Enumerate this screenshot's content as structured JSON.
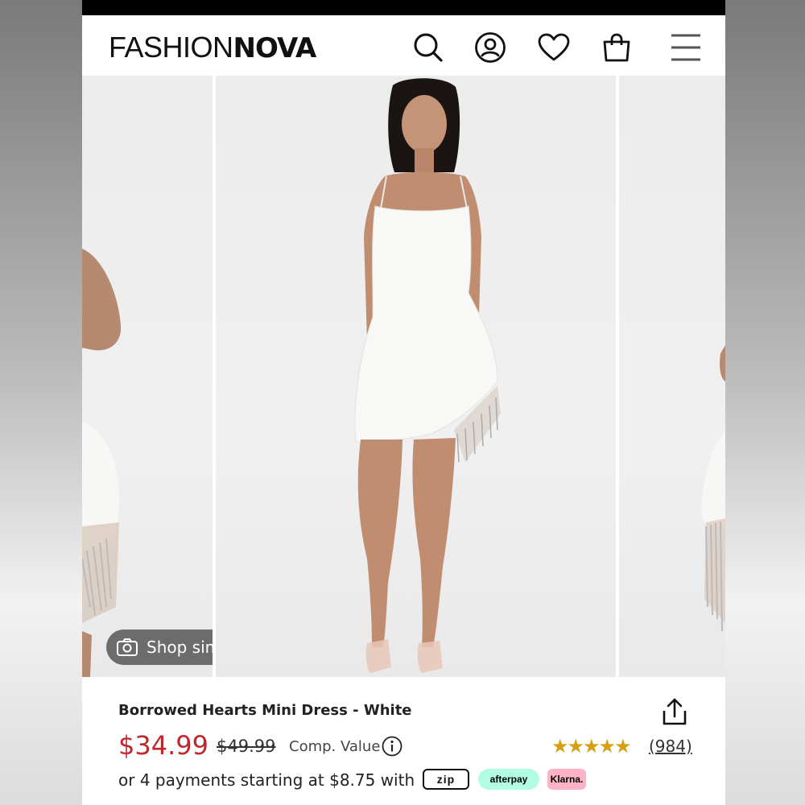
{
  "header": {
    "logo_thin": "FASHION",
    "logo_bold": "NOVA"
  },
  "icons": {
    "search": "search-icon",
    "account": "account-icon",
    "wishlist": "heart-icon",
    "cart": "bag-icon",
    "menu": "menu-icon"
  },
  "gallery": {
    "shop_similar_label": "Shop similar"
  },
  "product": {
    "title": "Borrowed Hearts Mini Dress - White",
    "price": "$34.99",
    "old_price": "$49.99",
    "comp_value_label": "Comp. Value",
    "rating_stars": "★★★★★",
    "review_count": "(984)",
    "payments_text": "or 4 payments starting at $8.75 with",
    "zip_label": "zip",
    "afterpay_label": "afterpay",
    "klarna_label": "Klarna."
  },
  "colors": {
    "price_red": "#c0262d",
    "star_gold": "#d4a017",
    "afterpay_mint": "#b2fce4",
    "klarna_pink": "#ffb3c7"
  }
}
